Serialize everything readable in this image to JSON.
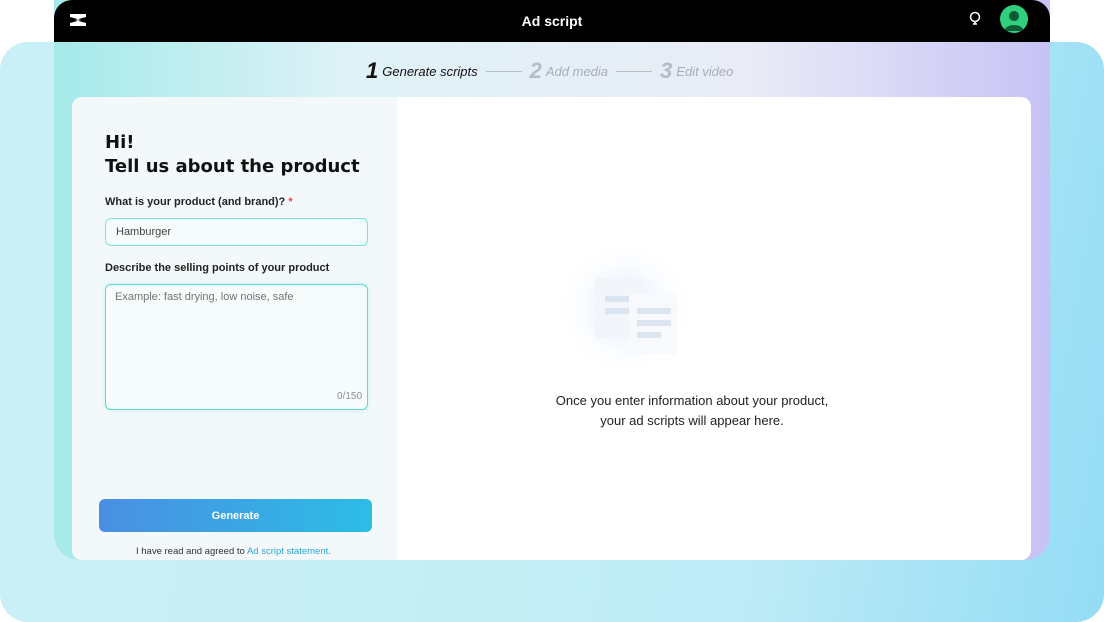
{
  "window": {
    "title": "Ad script"
  },
  "steps": [
    {
      "num": "1",
      "label": "Generate scripts"
    },
    {
      "num": "2",
      "label": "Add media"
    },
    {
      "num": "3",
      "label": "Edit video"
    }
  ],
  "form": {
    "greeting": "Hi!",
    "heading": "Tell us about the product",
    "product_label": "What is your product (and brand)?",
    "required_mark": "*",
    "product_value": "Hamburger",
    "selling_label": "Describe the selling points of your product",
    "selling_placeholder": "Example: fast drying, low noise, safe",
    "char_count": "0/150",
    "generate_label": "Generate",
    "agree_text": "I have read and agreed to",
    "agree_link": "Ad script statement."
  },
  "result": {
    "empty_message": "Once you enter information about your product, your ad scripts will appear here."
  },
  "colors": {
    "accent": "#2bbde6",
    "avatar": "#2fcf7e",
    "required": "#e5484d"
  },
  "icons": {
    "logo": "capcut-logo-icon",
    "bulb": "lightbulb-icon",
    "avatar": "user-avatar-icon",
    "empty": "documents-icon"
  }
}
